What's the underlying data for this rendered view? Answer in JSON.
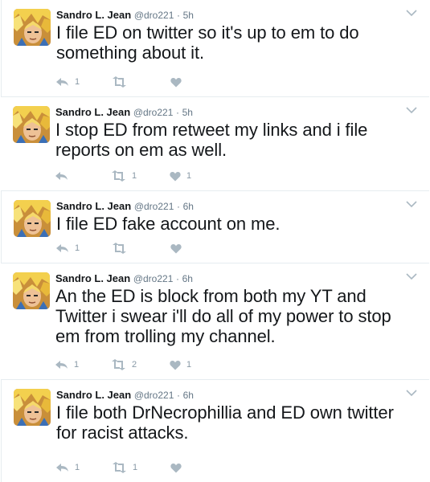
{
  "tweets": [
    {
      "name": "Sandro L. Jean",
      "handle": "@dro221",
      "separator": "·",
      "time": "5h",
      "text": "I file ED on twitter so it's up to em to do something about it.",
      "replies": "1",
      "retweets": "",
      "likes": ""
    },
    {
      "name": "Sandro L. Jean",
      "handle": "@dro221",
      "separator": "·",
      "time": "5h",
      "text": "I stop ED from retweet my links and i file reports on em  as well.",
      "replies": "",
      "retweets": "1",
      "likes": "1"
    },
    {
      "name": "Sandro L. Jean",
      "handle": "@dro221",
      "separator": "·",
      "time": "6h",
      "text": "I file ED fake account on me.",
      "replies": "1",
      "retweets": "",
      "likes": ""
    },
    {
      "name": "Sandro L. Jean",
      "handle": "@dro221",
      "separator": "·",
      "time": "6h",
      "text": "An the ED is block from both my YT and Twitter i swear i'll do all of my power to stop em from trolling my channel.",
      "replies": "1",
      "retweets": "2",
      "likes": "1"
    },
    {
      "name": "Sandro L. Jean",
      "handle": "@dro221",
      "separator": "·",
      "time": "6h",
      "text": "I file  both DrNecrophillia and ED own twitter for racist attacks.",
      "replies": "1",
      "retweets": "1",
      "likes": ""
    }
  ],
  "icons": {
    "reply": "reply-icon",
    "retweet": "retweet-icon",
    "like": "heart-icon",
    "caret": "chevron-down-icon"
  },
  "colors": {
    "icon": "#aab8c2",
    "name": "#14171a",
    "meta": "#657786",
    "divider": "#e6ecf0"
  }
}
